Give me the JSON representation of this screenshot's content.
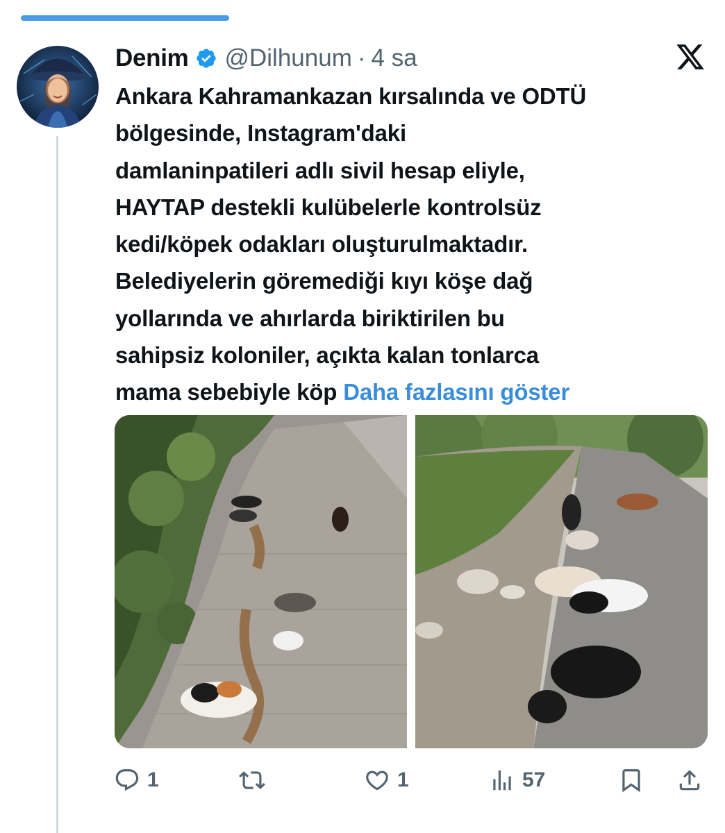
{
  "tweet": {
    "author": {
      "display_name": "Denim",
      "handle": "@Dilhunum",
      "verified": true
    },
    "separator": "·",
    "time": "4 sa",
    "text_lines": [
      "Ankara Kahramankazan kırsalında ve ODTÜ",
      "bölgesinde, Instagram'daki",
      "damlaninpatileri adlı sivil hesap eliyle,",
      "HAYTAP destekli kulübelerle kontrolsüz",
      "kedi/köpek odakları oluşturulmaktadır.",
      "Belediyelerin göremediği kıyı köşe dağ",
      "yollarında ve ahırlarda biriktirilen bu",
      "sahipsiz koloniler, açıkta kalan tonlarca",
      "mama sebebiyle köp "
    ],
    "show_more_label": "Daha fazlasını göster",
    "media": [
      {
        "icon": "photo-cats-on-sidewalk"
      },
      {
        "icon": "photo-dogs-on-road"
      }
    ],
    "actions": {
      "reply_count": "1",
      "retweet_count": "",
      "like_count": "1",
      "views_count": "57"
    }
  },
  "colors": {
    "accent": "#1d9bf0",
    "link": "#3a8dd8",
    "muted": "#536471",
    "top_bar": "#4c9be8"
  }
}
